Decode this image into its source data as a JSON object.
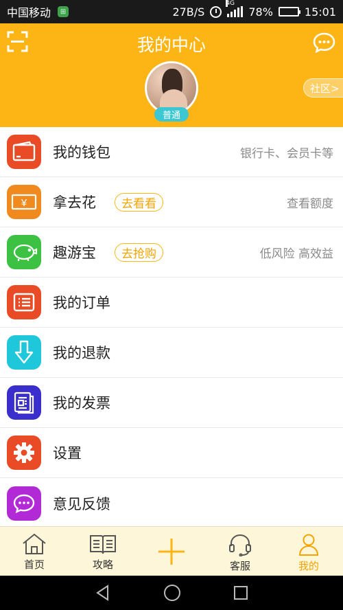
{
  "status_bar": {
    "carrier": "中国移动",
    "speed": "27B/S",
    "network": "4G",
    "battery": "78%",
    "battery_level": 0.78,
    "time": "15:01"
  },
  "header": {
    "title": "我的中心",
    "member_level": "普通",
    "community_label": "社区>"
  },
  "menu": [
    {
      "label": "我的钱包",
      "hint": "银行卡、会员卡等",
      "icon": "wallet-icon",
      "color": "#e84b25"
    },
    {
      "label": "拿去花",
      "tag": "去看看",
      "hint": "查看额度",
      "icon": "banknote-icon",
      "color": "#f08a1e"
    },
    {
      "label": "趣游宝",
      "tag": "去抢购",
      "hint": "低风险 高效益",
      "icon": "piggy-bank-icon",
      "color": "#3cc142"
    },
    {
      "label": "我的订单",
      "icon": "order-list-icon",
      "color": "#e84b25"
    },
    {
      "label": "我的退款",
      "icon": "refund-arrow-icon",
      "color": "#1ec7da"
    },
    {
      "label": "我的发票",
      "icon": "invoice-icon",
      "color": "#3a2fcc"
    },
    {
      "label": "设置",
      "icon": "gear-icon",
      "color": "#e84b25"
    },
    {
      "label": "意见反馈",
      "icon": "feedback-icon",
      "color": "#b12ad6"
    }
  ],
  "bottom_nav": {
    "home": "首页",
    "guide": "攻略",
    "service": "客服",
    "mine": "我的"
  },
  "colors": {
    "brand": "#fcb515",
    "active": "#f5a300"
  }
}
